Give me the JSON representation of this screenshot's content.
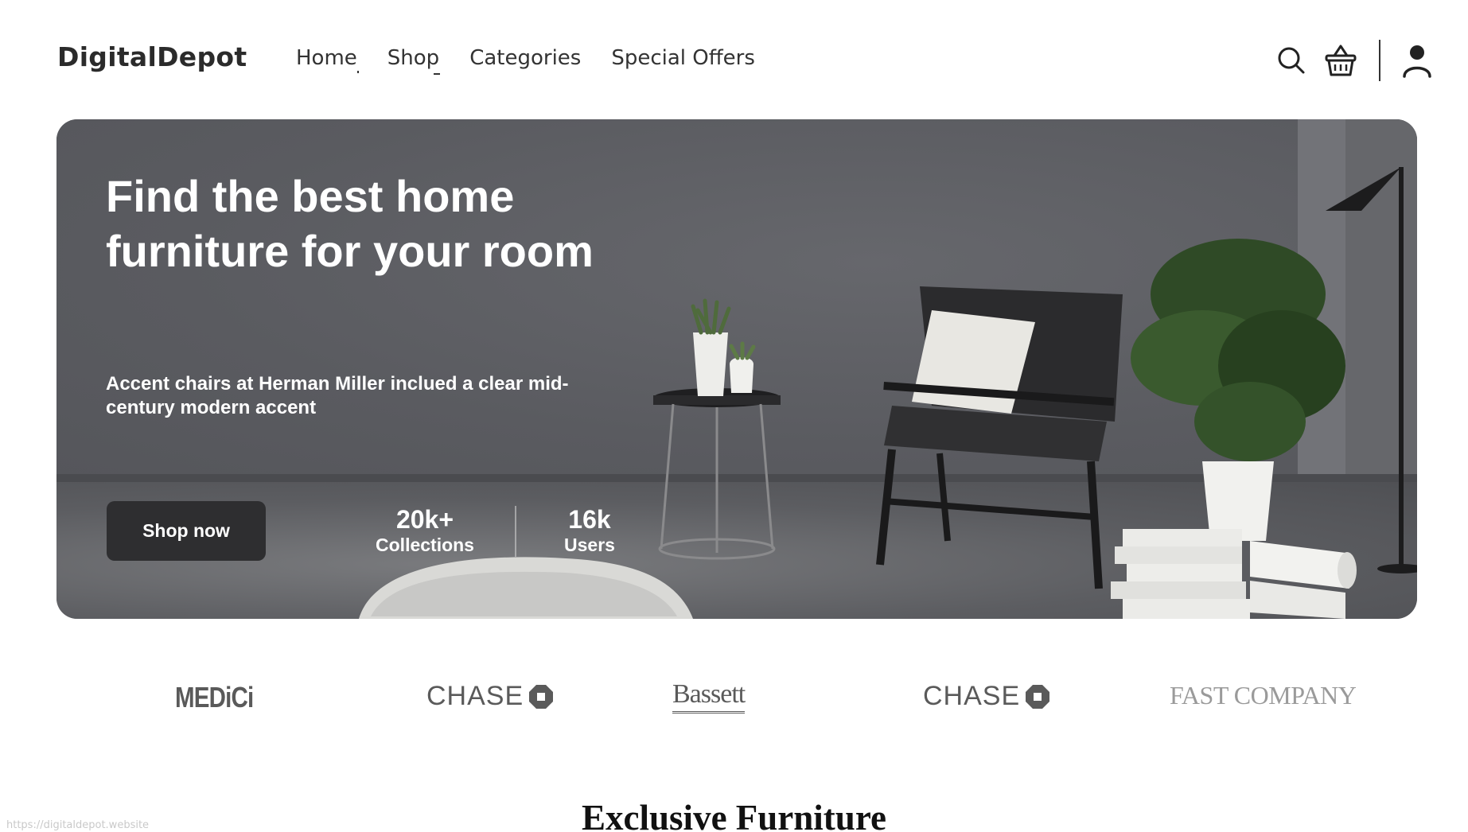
{
  "header": {
    "logo": "DigitalDepot",
    "nav": [
      {
        "label": "Home"
      },
      {
        "label": "Shop"
      },
      {
        "label": "Categories"
      },
      {
        "label": "Special Offers"
      }
    ],
    "icons": [
      "search-icon",
      "basket-icon",
      "user-icon"
    ]
  },
  "hero": {
    "title": "Find the best home furniture for your room",
    "subtitle": "Accent chairs at Herman Miller inclued a clear mid-century modern accent",
    "cta_label": "Shop now",
    "stats": [
      {
        "value": "20k+",
        "label": "Collections"
      },
      {
        "value": "16k",
        "label": "Users"
      }
    ]
  },
  "brands": [
    "MEDiCi",
    "CHASE",
    "Bassett",
    "CHASE",
    "FAST COMPANY"
  ],
  "section": {
    "title": "Exclusive Furniture"
  },
  "status_bar": {
    "url": "https://digitaldepot.website"
  },
  "colors": {
    "hero_bg": "#5c5d62",
    "cta_bg": "#2e2e30",
    "text_dark": "#222222"
  }
}
